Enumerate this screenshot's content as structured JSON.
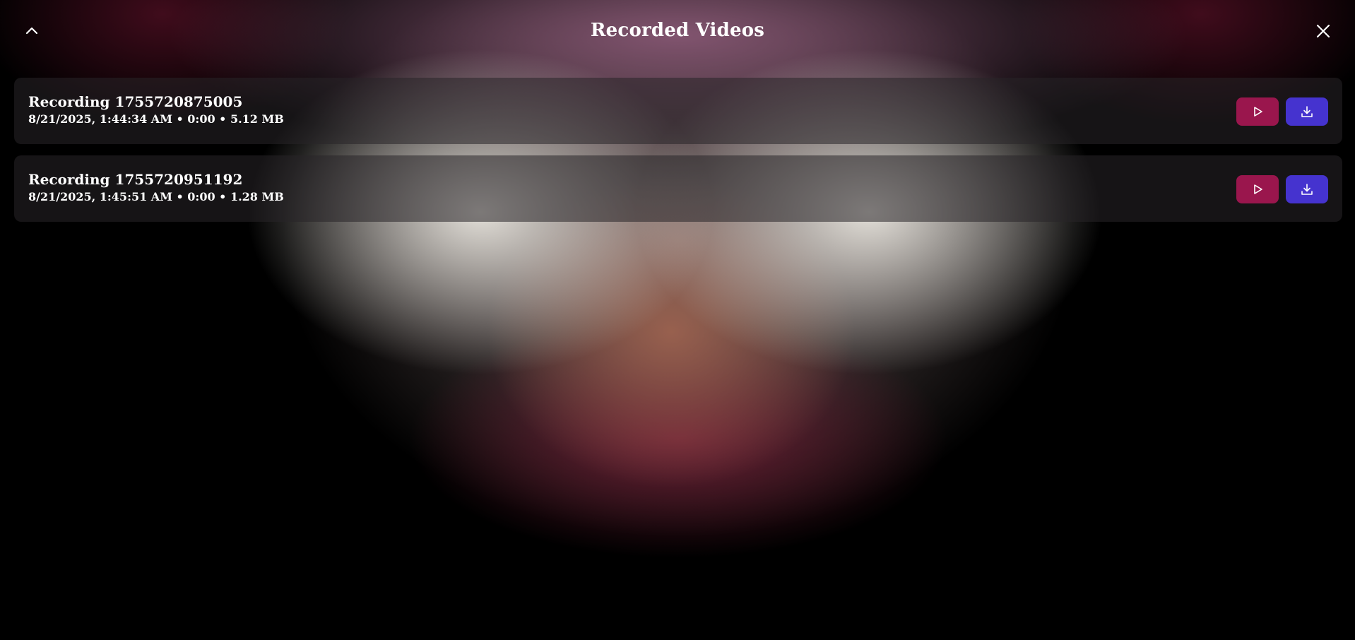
{
  "header": {
    "title": "Recorded Videos",
    "collapse_icon": "chevron-up-icon",
    "close_icon": "close-icon"
  },
  "recordings": [
    {
      "name": "Recording 1755720875005",
      "meta": "8/21/2025, 1:44:34 AM • 0:00 • 5.12 MB"
    },
    {
      "name": "Recording 1755720951192",
      "meta": "8/21/2025, 1:45:51 AM • 0:00 • 1.28 MB"
    }
  ],
  "icons": {
    "play": "play-icon",
    "download": "download-icon"
  },
  "colors": {
    "play_button": "#9a164d",
    "download_button": "#4533cf"
  }
}
